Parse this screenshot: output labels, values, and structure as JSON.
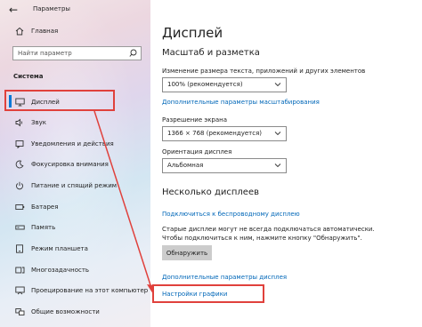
{
  "window": {
    "title": "Параметры",
    "back_icon": "back-arrow-icon"
  },
  "sidebar": {
    "home": {
      "label": "Главная",
      "icon": "home-icon"
    },
    "search_placeholder": "Найти параметр",
    "section": "Система",
    "items": [
      {
        "label": "Дисплей",
        "icon": "display-icon",
        "selected": true
      },
      {
        "label": "Звук",
        "icon": "speaker-icon"
      },
      {
        "label": "Уведомления и действия",
        "icon": "notifications-icon"
      },
      {
        "label": "Фокусировка внимания",
        "icon": "moon-icon"
      },
      {
        "label": "Питание и спящий режим",
        "icon": "power-icon"
      },
      {
        "label": "Батарея",
        "icon": "battery-icon"
      },
      {
        "label": "Память",
        "icon": "storage-icon"
      },
      {
        "label": "Режим планшета",
        "icon": "tablet-icon"
      },
      {
        "label": "Многозадачность",
        "icon": "multitasking-icon"
      },
      {
        "label": "Проецирование на этот компьютер",
        "icon": "projecting-icon"
      },
      {
        "label": "Общие возможности",
        "icon": "shared-experiences-icon"
      }
    ]
  },
  "main": {
    "title": "Дисплей",
    "scale_heading": "Масштаб и разметка",
    "scale_label": "Изменение размера текста, приложений и других элементов",
    "scale_value": "100% (рекомендуется)",
    "scale_link": "Дополнительные параметры масштабирования",
    "resolution_label": "Разрешение экрана",
    "resolution_value": "1366 × 768 (рекомендуется)",
    "orientation_label": "Ориентация дисплея",
    "orientation_value": "Альбомная",
    "multi_heading": "Несколько дисплеев",
    "wireless_link": "Подключиться к беспроводному дисплею",
    "old_displays_line1": "Старые дисплеи могут не всегда подключаться автоматически.",
    "old_displays_line2": "Чтобы подключиться к ним, нажмите кнопку \"Обнаружить\".",
    "detect_button": "Обнаружить",
    "advanced_link": "Дополнительные параметры дисплея",
    "graphics_link": "Настройки графики"
  },
  "accent_color": "#0078d7",
  "annotation_color": "#e0413c"
}
